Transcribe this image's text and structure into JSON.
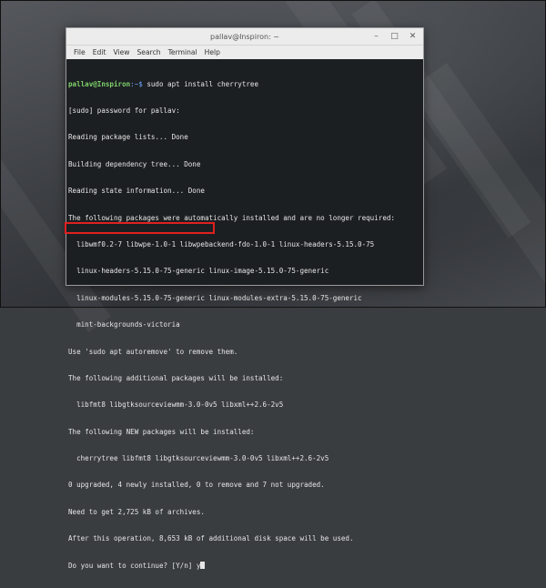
{
  "window": {
    "title": "pallav@Inspiron: ~",
    "controls": {
      "minimize": "–",
      "maximize": "□",
      "close": "✕"
    }
  },
  "menu": [
    "File",
    "Edit",
    "View",
    "Search",
    "Terminal",
    "Help"
  ],
  "terminal": {
    "prompt_user": "pallav@Inspiron",
    "prompt_path": ":~$",
    "command": " sudo apt install cherrytree",
    "lines": [
      "[sudo] password for pallav:",
      "Reading package lists... Done",
      "Building dependency tree... Done",
      "Reading state information... Done",
      "The following packages were automatically installed and are no longer required:",
      "  libwmf0.2-7 libwpe-1.0-1 libwpebackend-fdo-1.0-1 linux-headers-5.15.0-75",
      "  linux-headers-5.15.0-75-generic linux-image-5.15.0-75-generic",
      "  linux-modules-5.15.0-75-generic linux-modules-extra-5.15.0-75-generic",
      "  mint-backgrounds-victoria",
      "Use 'sudo apt autoremove' to remove them.",
      "The following additional packages will be installed:",
      "  libfmt8 libgtksourceviewmm-3.0-0v5 libxml++2.6-2v5",
      "The following NEW packages will be installed:",
      "  cherrytree libfmt8 libgtksourceviewmm-3.0-0v5 libxml++2.6-2v5",
      "0 upgraded, 4 newly installed, 0 to remove and 7 not upgraded.",
      "Need to get 2,725 kB of archives.",
      "After this operation, 8,653 kB of additional disk space will be used."
    ],
    "confirm_prompt": "Do you want to continue? [Y/n] ",
    "confirm_input": "y"
  }
}
